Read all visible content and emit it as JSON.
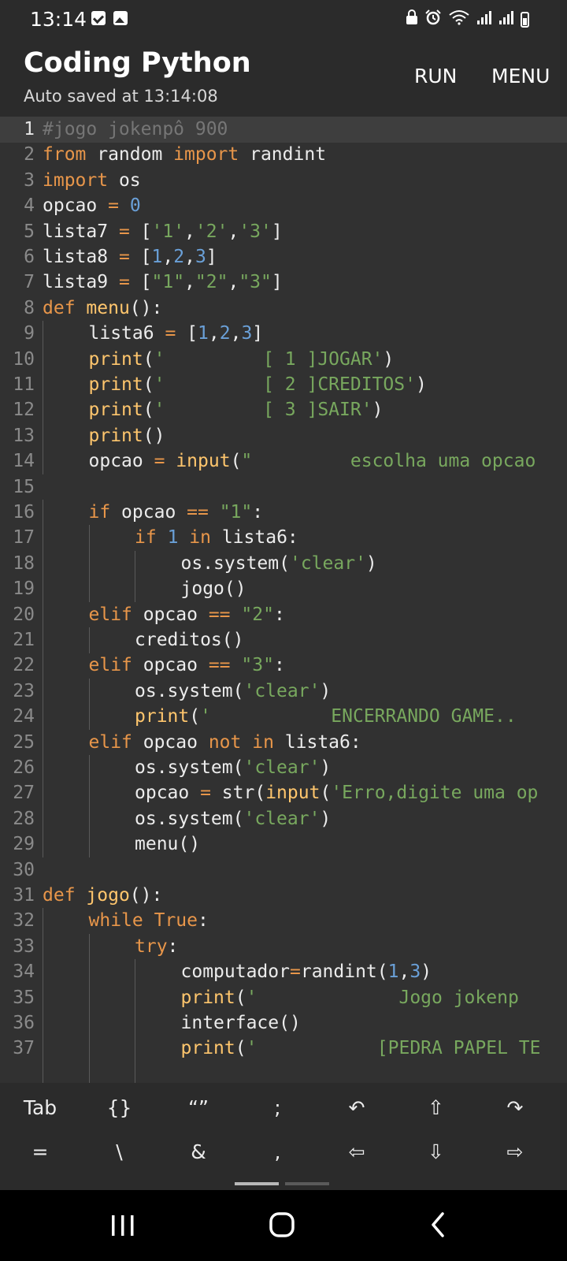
{
  "status_bar": {
    "time": "13:14",
    "left_icons": [
      "message-check-icon",
      "gallery-icon"
    ],
    "right_icons": [
      "lock-icon",
      "alarm-icon",
      "wifi-icon",
      "signal-icon",
      "signal-icon",
      "battery-icon"
    ]
  },
  "app_bar": {
    "title": "Coding Python",
    "subtitle": "Auto saved at 13:14:08",
    "run_label": "RUN",
    "menu_label": "MENU"
  },
  "editor": {
    "active_line": 1,
    "lines": [
      {
        "n": "1",
        "ind": 0,
        "tokens": [
          [
            "cm",
            "#jogo jokenpô 900"
          ]
        ]
      },
      {
        "n": "2",
        "ind": 0,
        "tokens": [
          [
            "kw",
            "from"
          ],
          [
            "pl",
            " random "
          ],
          [
            "kw",
            "import"
          ],
          [
            "pl",
            " randint"
          ]
        ]
      },
      {
        "n": "3",
        "ind": 0,
        "tokens": [
          [
            "kw",
            "import"
          ],
          [
            "pl",
            " os"
          ]
        ]
      },
      {
        "n": "4",
        "ind": 0,
        "tokens": [
          [
            "pl",
            "opcao "
          ],
          [
            "kw",
            "="
          ],
          [
            "pl",
            " "
          ],
          [
            "num",
            "0"
          ]
        ]
      },
      {
        "n": "5",
        "ind": 0,
        "tokens": [
          [
            "pl",
            "lista7 "
          ],
          [
            "kw",
            "="
          ],
          [
            "pl",
            " ["
          ],
          [
            "str",
            "'1'"
          ],
          [
            "pl",
            ","
          ],
          [
            "str",
            "'2'"
          ],
          [
            "pl",
            ","
          ],
          [
            "str",
            "'3'"
          ],
          [
            "pl",
            "]"
          ]
        ]
      },
      {
        "n": "6",
        "ind": 0,
        "tokens": [
          [
            "pl",
            "lista8 "
          ],
          [
            "kw",
            "="
          ],
          [
            "pl",
            " ["
          ],
          [
            "num",
            "1"
          ],
          [
            "pl",
            ","
          ],
          [
            "num",
            "2"
          ],
          [
            "pl",
            ","
          ],
          [
            "num",
            "3"
          ],
          [
            "pl",
            "]"
          ]
        ]
      },
      {
        "n": "7",
        "ind": 0,
        "tokens": [
          [
            "pl",
            "lista9 "
          ],
          [
            "kw",
            "="
          ],
          [
            "pl",
            " ["
          ],
          [
            "str",
            "\"1\""
          ],
          [
            "pl",
            ","
          ],
          [
            "str",
            "\"2\""
          ],
          [
            "pl",
            ","
          ],
          [
            "str",
            "\"3\""
          ],
          [
            "pl",
            "]"
          ]
        ]
      },
      {
        "n": "8",
        "ind": 0,
        "tokens": [
          [
            "kw",
            "def"
          ],
          [
            "pl",
            " "
          ],
          [
            "fn",
            "menu"
          ],
          [
            "pl",
            "():"
          ]
        ]
      },
      {
        "n": "9",
        "ind": 1,
        "tokens": [
          [
            "pl",
            "lista6 "
          ],
          [
            "kw",
            "="
          ],
          [
            "pl",
            " ["
          ],
          [
            "num",
            "1"
          ],
          [
            "pl",
            ","
          ],
          [
            "num",
            "2"
          ],
          [
            "pl",
            ","
          ],
          [
            "num",
            "3"
          ],
          [
            "pl",
            "]"
          ]
        ]
      },
      {
        "n": "10",
        "ind": 1,
        "tokens": [
          [
            "fn",
            "print"
          ],
          [
            "pl",
            "("
          ],
          [
            "str",
            "'         [ 1 ]JOGAR'"
          ],
          [
            "pl",
            ")"
          ]
        ]
      },
      {
        "n": "11",
        "ind": 1,
        "tokens": [
          [
            "fn",
            "print"
          ],
          [
            "pl",
            "("
          ],
          [
            "str",
            "'         [ 2 ]CREDITOS'"
          ],
          [
            "pl",
            ")"
          ]
        ]
      },
      {
        "n": "12",
        "ind": 1,
        "tokens": [
          [
            "fn",
            "print"
          ],
          [
            "pl",
            "("
          ],
          [
            "str",
            "'         [ 3 ]SAIR'"
          ],
          [
            "pl",
            ")"
          ]
        ]
      },
      {
        "n": "13",
        "ind": 1,
        "tokens": [
          [
            "fn",
            "print"
          ],
          [
            "pl",
            "()"
          ]
        ]
      },
      {
        "n": "14",
        "ind": 1,
        "tokens": [
          [
            "pl",
            "opcao "
          ],
          [
            "kw",
            "="
          ],
          [
            "pl",
            " "
          ],
          [
            "fn",
            "input"
          ],
          [
            "pl",
            "("
          ],
          [
            "str",
            "\"         escolha uma opcao"
          ]
        ]
      },
      {
        "n": "15",
        "ind": 0,
        "tokens": []
      },
      {
        "n": "16",
        "ind": 1,
        "tokens": [
          [
            "kw",
            "if"
          ],
          [
            "pl",
            " opcao "
          ],
          [
            "kw",
            "=="
          ],
          [
            "pl",
            " "
          ],
          [
            "str",
            "\"1\""
          ],
          [
            "pl",
            ":"
          ]
        ]
      },
      {
        "n": "17",
        "ind": 2,
        "tokens": [
          [
            "kw",
            "if"
          ],
          [
            "pl",
            " "
          ],
          [
            "num",
            "1"
          ],
          [
            "pl",
            " "
          ],
          [
            "kw",
            "in"
          ],
          [
            "pl",
            " lista6:"
          ]
        ]
      },
      {
        "n": "18",
        "ind": 3,
        "tokens": [
          [
            "pl",
            "os.system("
          ],
          [
            "str",
            "'clear'"
          ],
          [
            "pl",
            ")"
          ]
        ]
      },
      {
        "n": "19",
        "ind": 3,
        "tokens": [
          [
            "pl",
            "jogo()"
          ]
        ]
      },
      {
        "n": "20",
        "ind": 1,
        "tokens": [
          [
            "kw",
            "elif"
          ],
          [
            "pl",
            " opcao "
          ],
          [
            "kw",
            "=="
          ],
          [
            "pl",
            " "
          ],
          [
            "str",
            "\"2\""
          ],
          [
            "pl",
            ":"
          ]
        ]
      },
      {
        "n": "21",
        "ind": 2,
        "tokens": [
          [
            "pl",
            "creditos()"
          ]
        ]
      },
      {
        "n": "22",
        "ind": 1,
        "tokens": [
          [
            "kw",
            "elif"
          ],
          [
            "pl",
            " opcao "
          ],
          [
            "kw",
            "=="
          ],
          [
            "pl",
            " "
          ],
          [
            "str",
            "\"3\""
          ],
          [
            "pl",
            ":"
          ]
        ]
      },
      {
        "n": "23",
        "ind": 2,
        "tokens": [
          [
            "pl",
            "os.system("
          ],
          [
            "str",
            "'clear'"
          ],
          [
            "pl",
            ")"
          ]
        ]
      },
      {
        "n": "24",
        "ind": 2,
        "tokens": [
          [
            "fn",
            "print"
          ],
          [
            "pl",
            "("
          ],
          [
            "str",
            "'           ENCERRANDO GAME.."
          ]
        ]
      },
      {
        "n": "25",
        "ind": 1,
        "tokens": [
          [
            "kw",
            "elif"
          ],
          [
            "pl",
            " opcao "
          ],
          [
            "kw",
            "not"
          ],
          [
            "pl",
            " "
          ],
          [
            "kw",
            "in"
          ],
          [
            "pl",
            " lista6:"
          ]
        ]
      },
      {
        "n": "26",
        "ind": 2,
        "tokens": [
          [
            "pl",
            "os.system("
          ],
          [
            "str",
            "'clear'"
          ],
          [
            "pl",
            ")"
          ]
        ]
      },
      {
        "n": "27",
        "ind": 2,
        "tokens": [
          [
            "pl",
            "opcao "
          ],
          [
            "kw",
            "="
          ],
          [
            "pl",
            " str("
          ],
          [
            "fn",
            "input"
          ],
          [
            "pl",
            "("
          ],
          [
            "str",
            "'Erro,digite uma op"
          ]
        ]
      },
      {
        "n": "28",
        "ind": 2,
        "tokens": [
          [
            "pl",
            "os.system("
          ],
          [
            "str",
            "'clear'"
          ],
          [
            "pl",
            ")"
          ]
        ]
      },
      {
        "n": "29",
        "ind": 2,
        "tokens": [
          [
            "pl",
            "menu()"
          ]
        ]
      },
      {
        "n": "30",
        "ind": 0,
        "tokens": []
      },
      {
        "n": "31",
        "ind": 0,
        "tokens": [
          [
            "kw",
            "def"
          ],
          [
            "pl",
            " "
          ],
          [
            "fn",
            "jogo"
          ],
          [
            "pl",
            "():"
          ]
        ]
      },
      {
        "n": "32",
        "ind": 1,
        "tokens": [
          [
            "kw",
            "while"
          ],
          [
            "pl",
            " "
          ],
          [
            "kw",
            "True"
          ],
          [
            "pl",
            ":"
          ]
        ]
      },
      {
        "n": "33",
        "ind": 2,
        "tokens": [
          [
            "kw",
            "try"
          ],
          [
            "pl",
            ":"
          ]
        ]
      },
      {
        "n": "34",
        "ind": 3,
        "tokens": [
          [
            "pl",
            "computador"
          ],
          [
            "kw",
            "="
          ],
          [
            "pl",
            "randint("
          ],
          [
            "num",
            "1"
          ],
          [
            "pl",
            ","
          ],
          [
            "num",
            "3"
          ],
          [
            "pl",
            ")"
          ]
        ]
      },
      {
        "n": "35",
        "ind": 3,
        "tokens": [
          [
            "fn",
            "print"
          ],
          [
            "pl",
            "("
          ],
          [
            "str",
            "'             Jogo jokenp"
          ]
        ]
      },
      {
        "n": "36",
        "ind": 3,
        "tokens": [
          [
            "pl",
            "interface()"
          ]
        ]
      },
      {
        "n": "37",
        "ind": 3,
        "tokens": [
          [
            "fn",
            "print"
          ],
          [
            "pl",
            "("
          ],
          [
            "str",
            "'           [PEDRA PAPEL TE"
          ]
        ]
      },
      {
        "n": "",
        "ind": 3,
        "tokens": []
      }
    ]
  },
  "keyboard": {
    "row1": [
      {
        "label": "Tab",
        "name": "tab-key"
      },
      {
        "label": "{}",
        "name": "braces-key"
      },
      {
        "label": "“”",
        "name": "quotes-key"
      },
      {
        "label": ";",
        "name": "semicolon-key"
      },
      {
        "label": "↶",
        "name": "undo-icon"
      },
      {
        "label": "⇧",
        "name": "arrow-up-icon"
      },
      {
        "label": "↷",
        "name": "redo-icon"
      }
    ],
    "row2": [
      {
        "label": "=",
        "name": "equals-key"
      },
      {
        "label": "\\",
        "name": "backslash-key"
      },
      {
        "label": "&",
        "name": "ampersand-key"
      },
      {
        "label": ",",
        "name": "comma-key"
      },
      {
        "label": "⇦",
        "name": "arrow-left-icon"
      },
      {
        "label": "⇩",
        "name": "arrow-down-icon"
      },
      {
        "label": "⇨",
        "name": "arrow-right-icon"
      }
    ]
  },
  "nav_bar": {
    "buttons": [
      "recents-icon",
      "home-icon",
      "back-icon"
    ]
  }
}
